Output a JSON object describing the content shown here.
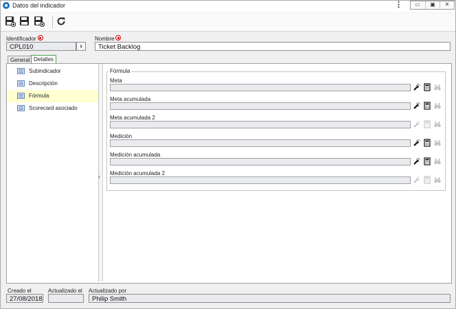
{
  "window": {
    "title": "Datos del indicador",
    "menu_glyph": "⋮",
    "buttons": {
      "minimize": "▭",
      "restore": "▣",
      "close": "✕"
    }
  },
  "toolbar": {
    "items": [
      "save-and-new-icon",
      "save-icon",
      "save-and-close-icon",
      "refresh-icon"
    ]
  },
  "header": {
    "identificador_label": "Identificador",
    "identificador_value": "CPL010",
    "nombre_label": "Nombre",
    "nombre_value": "Ticket Backlog"
  },
  "tabs": [
    {
      "label": "General",
      "active": false
    },
    {
      "label": "Detalles",
      "active": true
    }
  ],
  "nav": {
    "items": [
      {
        "label": "Subindicador",
        "selected": false
      },
      {
        "label": "Descripción",
        "selected": false
      },
      {
        "label": "Fórmula",
        "selected": true
      },
      {
        "label": "Scorecard asociado",
        "selected": false
      }
    ],
    "collapse_glyph": "‹"
  },
  "formula": {
    "legend": "Fórmula",
    "fields": [
      {
        "label": "Meta",
        "value": "",
        "enabled": true
      },
      {
        "label": "Meta acumulada",
        "value": "",
        "enabled": true
      },
      {
        "label": "Meta acumulada 2",
        "value": "",
        "enabled": false
      },
      {
        "label": "Medición",
        "value": "",
        "enabled": true
      },
      {
        "label": "Medición acumulada",
        "value": "",
        "enabled": true
      },
      {
        "label": "Medición acumulada 2",
        "value": "",
        "enabled": false
      }
    ],
    "icons": [
      "wand-icon",
      "calculator-icon",
      "binoculars-icon"
    ]
  },
  "footer": {
    "creado_label": "Creado el",
    "creado_value": "27/08/2018",
    "actualizado_label": "Actualizado el",
    "actualizado_value": "",
    "actualizado_por_label": "Actualizado por",
    "actualizado_por_value": "Philip Smith"
  },
  "colors": {
    "accent_blue": "#1e73be",
    "required_red": "#dd0000",
    "selected_row": "#ffffd0",
    "active_tab_border": "#4d9a4d"
  }
}
